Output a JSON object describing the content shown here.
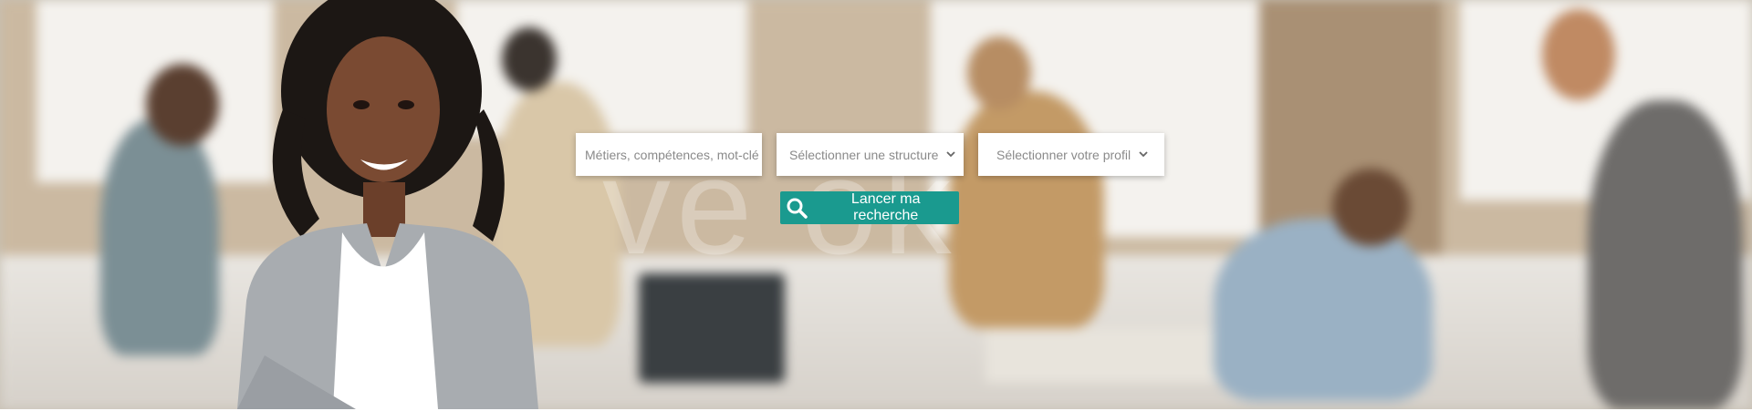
{
  "search": {
    "keywords_placeholder": "Métiers, compétences, mot-clé",
    "keywords_value": "",
    "structure_label": "Sélectionner une structure",
    "profile_label": "Sélectionner votre profil",
    "submit_label": "Lancer ma recherche"
  },
  "icons": {
    "search": "magnifier-icon",
    "dropdown": "chevron-down-icon"
  },
  "colors": {
    "accent": "#1a9a8f",
    "field_bg": "#ffffff",
    "placeholder_text": "#8a8a8a"
  }
}
